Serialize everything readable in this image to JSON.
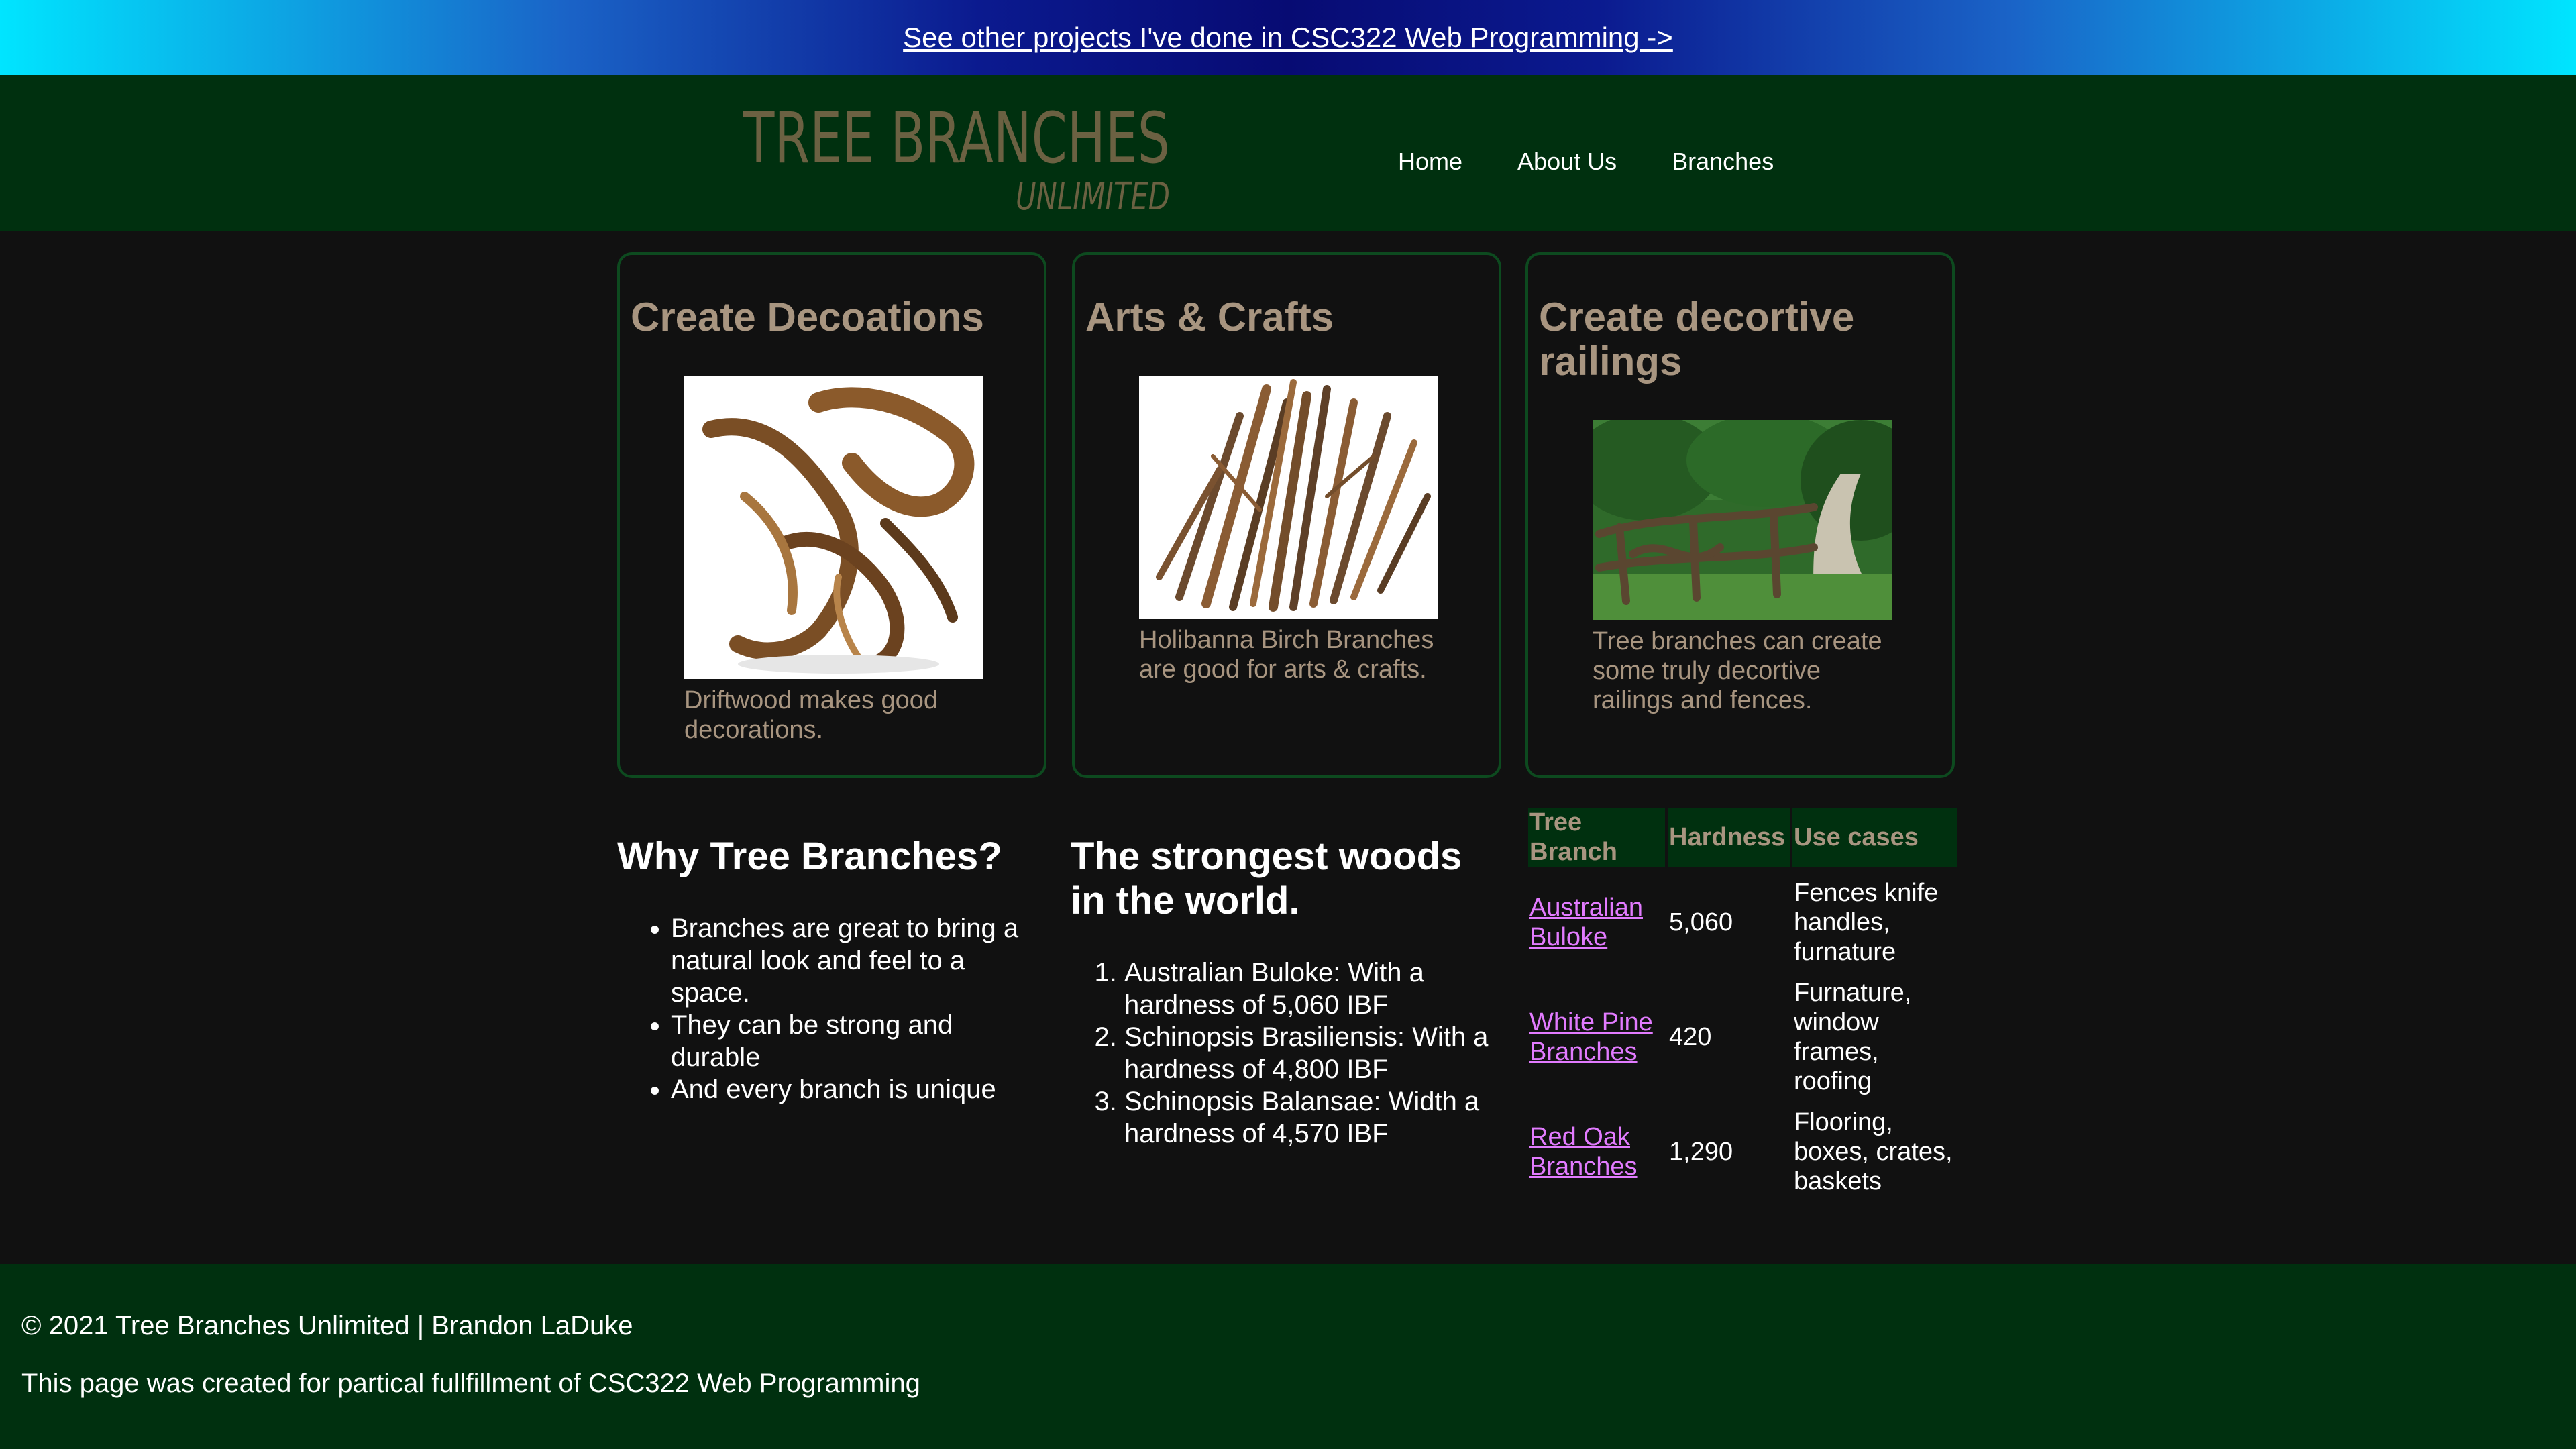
{
  "banner": {
    "link_text": "See other projects I've done in CSC322 Web Programming ->"
  },
  "header": {
    "logo_line1": "TREE BRANCHES",
    "logo_line2": "UNLIMITED",
    "nav": [
      "Home",
      "About Us",
      "Branches"
    ]
  },
  "cards": [
    {
      "title": "Create Decoations",
      "caption": "Driftwood makes good decorations."
    },
    {
      "title": "Arts & Crafts",
      "caption": "Holibanna Birch Branches are good for arts & crafts."
    },
    {
      "title": "Create decortive railings",
      "caption": "Tree branches can create some truly decortive railings and fences."
    }
  ],
  "why": {
    "title": "Why Tree Branches?",
    "items": [
      "Branches are great to bring a natural look and feel to a space.",
      "They can be strong and durable",
      "And every branch is unique"
    ]
  },
  "strongest": {
    "title": "The strongest woods in the world.",
    "items": [
      "Australian Buloke: With a hardness of 5,060 IBF",
      "Schinopsis Brasiliensis: With a hardness of 4,800 IBF",
      "Schinopsis Balansae: Width a hardness of 4,570 IBF"
    ]
  },
  "table": {
    "headers": [
      "Tree Branch",
      "Hardness",
      "Use cases"
    ],
    "rows": [
      {
        "name": "Australian Buloke",
        "hardness": "5,060",
        "uses": "Fences knife handles, furnature"
      },
      {
        "name": "White Pine Branches",
        "hardness": "420",
        "uses": "Furnature, window frames, roofing"
      },
      {
        "name": "Red Oak Branches",
        "hardness": "1,290",
        "uses": "Flooring, boxes, crates, baskets"
      }
    ]
  },
  "footer": {
    "copyright": "© 2021 Tree Branches Unlimited | Brandon LaDuke",
    "note": "This page was created for partical fullfillment of CSC322 Web Programming"
  },
  "colors": {
    "dark_green": "#00300f",
    "tan": "#a89580",
    "link_purple": "#e27bff",
    "page_bg": "#111111"
  }
}
